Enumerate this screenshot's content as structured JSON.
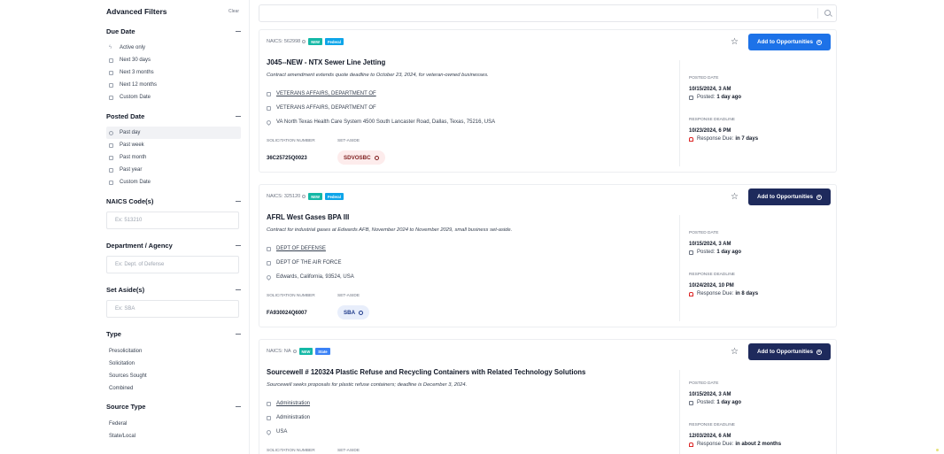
{
  "sidebar": {
    "title": "Advanced Filters",
    "clear": "Clear",
    "due_date": {
      "title": "Due Date",
      "options": [
        "Active only",
        "Next 30 days",
        "Next 3 months",
        "Next 12 months",
        "Custom Date"
      ]
    },
    "posted_date": {
      "title": "Posted Date",
      "options": [
        "Past day",
        "Past week",
        "Past month",
        "Past year",
        "Custom Date"
      ]
    },
    "naics": {
      "title": "NAICS Code(s)",
      "placeholder": "Ex: 513210"
    },
    "department": {
      "title": "Department / Agency",
      "placeholder": "Ex: Dept. of Defense"
    },
    "set_aside": {
      "title": "Set Aside(s)",
      "placeholder": "Ex: SBA"
    },
    "type": {
      "title": "Type",
      "options": [
        "Presolicitation",
        "Solicitation",
        "Sources Sought",
        "Combined"
      ]
    },
    "source_type": {
      "title": "Source Type",
      "options": [
        "Federal",
        "State/Local"
      ]
    }
  },
  "search": {
    "placeholder": ""
  },
  "labels": {
    "add_button": "Add to Opportunities",
    "solicitation_number": "SOLICITATION NUMBER",
    "set_aside": "SET-ASIDE",
    "posted_date": "POSTED DATE",
    "response_deadline": "RESPONSE DEADLINE",
    "posted_prefix": "Posted:",
    "response_prefix": "Response Due:"
  },
  "cards": [
    {
      "naics": "NAICS: 562998",
      "badge_new": "NEW",
      "badge_type": "Federal",
      "title": "J045--NEW - NTX Sewer Line Jetting",
      "description": "Contract amendment extends quote deadline to October 23, 2024, for veteran-owned businesses.",
      "department": "VETERANS AFFAIRS, DEPARTMENT OF",
      "sub_agency": "VETERANS AFFAIRS, DEPARTMENT OF",
      "location": "VA North Texas Health Care System 4500 South Lancaster Road, Dallas, Texas, 75216, USA",
      "solicitation_number": "36C25725Q0023",
      "set_aside": "SDVOSBC",
      "posted_date": "10/15/2024, 3 AM",
      "posted_ago": "1 day ago",
      "deadline": "10/23/2024, 6 PM",
      "due_in": "in 7 days"
    },
    {
      "naics": "NAICS: 325120",
      "badge_new": "NEW",
      "badge_type": "Federal",
      "title": "AFRL West Gases BPA III",
      "description": "Contract for industrial gases at Edwards AFB, November 2024 to November 2029, small business set-aside.",
      "department": "DEPT OF DEFENSE",
      "sub_agency": "DEPT OF THE AIR FORCE",
      "location": "Edwards, California, 93524, USA",
      "solicitation_number": "FA930024Q6007",
      "set_aside": "SBA",
      "posted_date": "10/15/2024, 3 AM",
      "posted_ago": "1 day ago",
      "deadline": "10/24/2024, 10 PM",
      "due_in": "in 8 days"
    },
    {
      "naics": "NAICS: NA",
      "badge_new": "NEW",
      "badge_type": "State",
      "title": "Sourcewell # 120324 Plastic Refuse and Recycling Containers with Related Technology Solutions",
      "description": "Sourcewell seeks proposals for plastic refuse containers; deadline is December 3, 2024.",
      "department": "Administration",
      "sub_agency": "Administration",
      "location": "USA",
      "posted_date": "10/15/2024, 3 AM",
      "posted_ago": "1 day ago",
      "deadline": "12/03/2024, 6 AM",
      "due_in": "in about 2 months"
    }
  ],
  "colors": {
    "primary_button": "#1d72e8",
    "navy_button": "#1e2a5c",
    "badge_new": "#14b8a6",
    "badge_type": "#0ea5e9"
  }
}
